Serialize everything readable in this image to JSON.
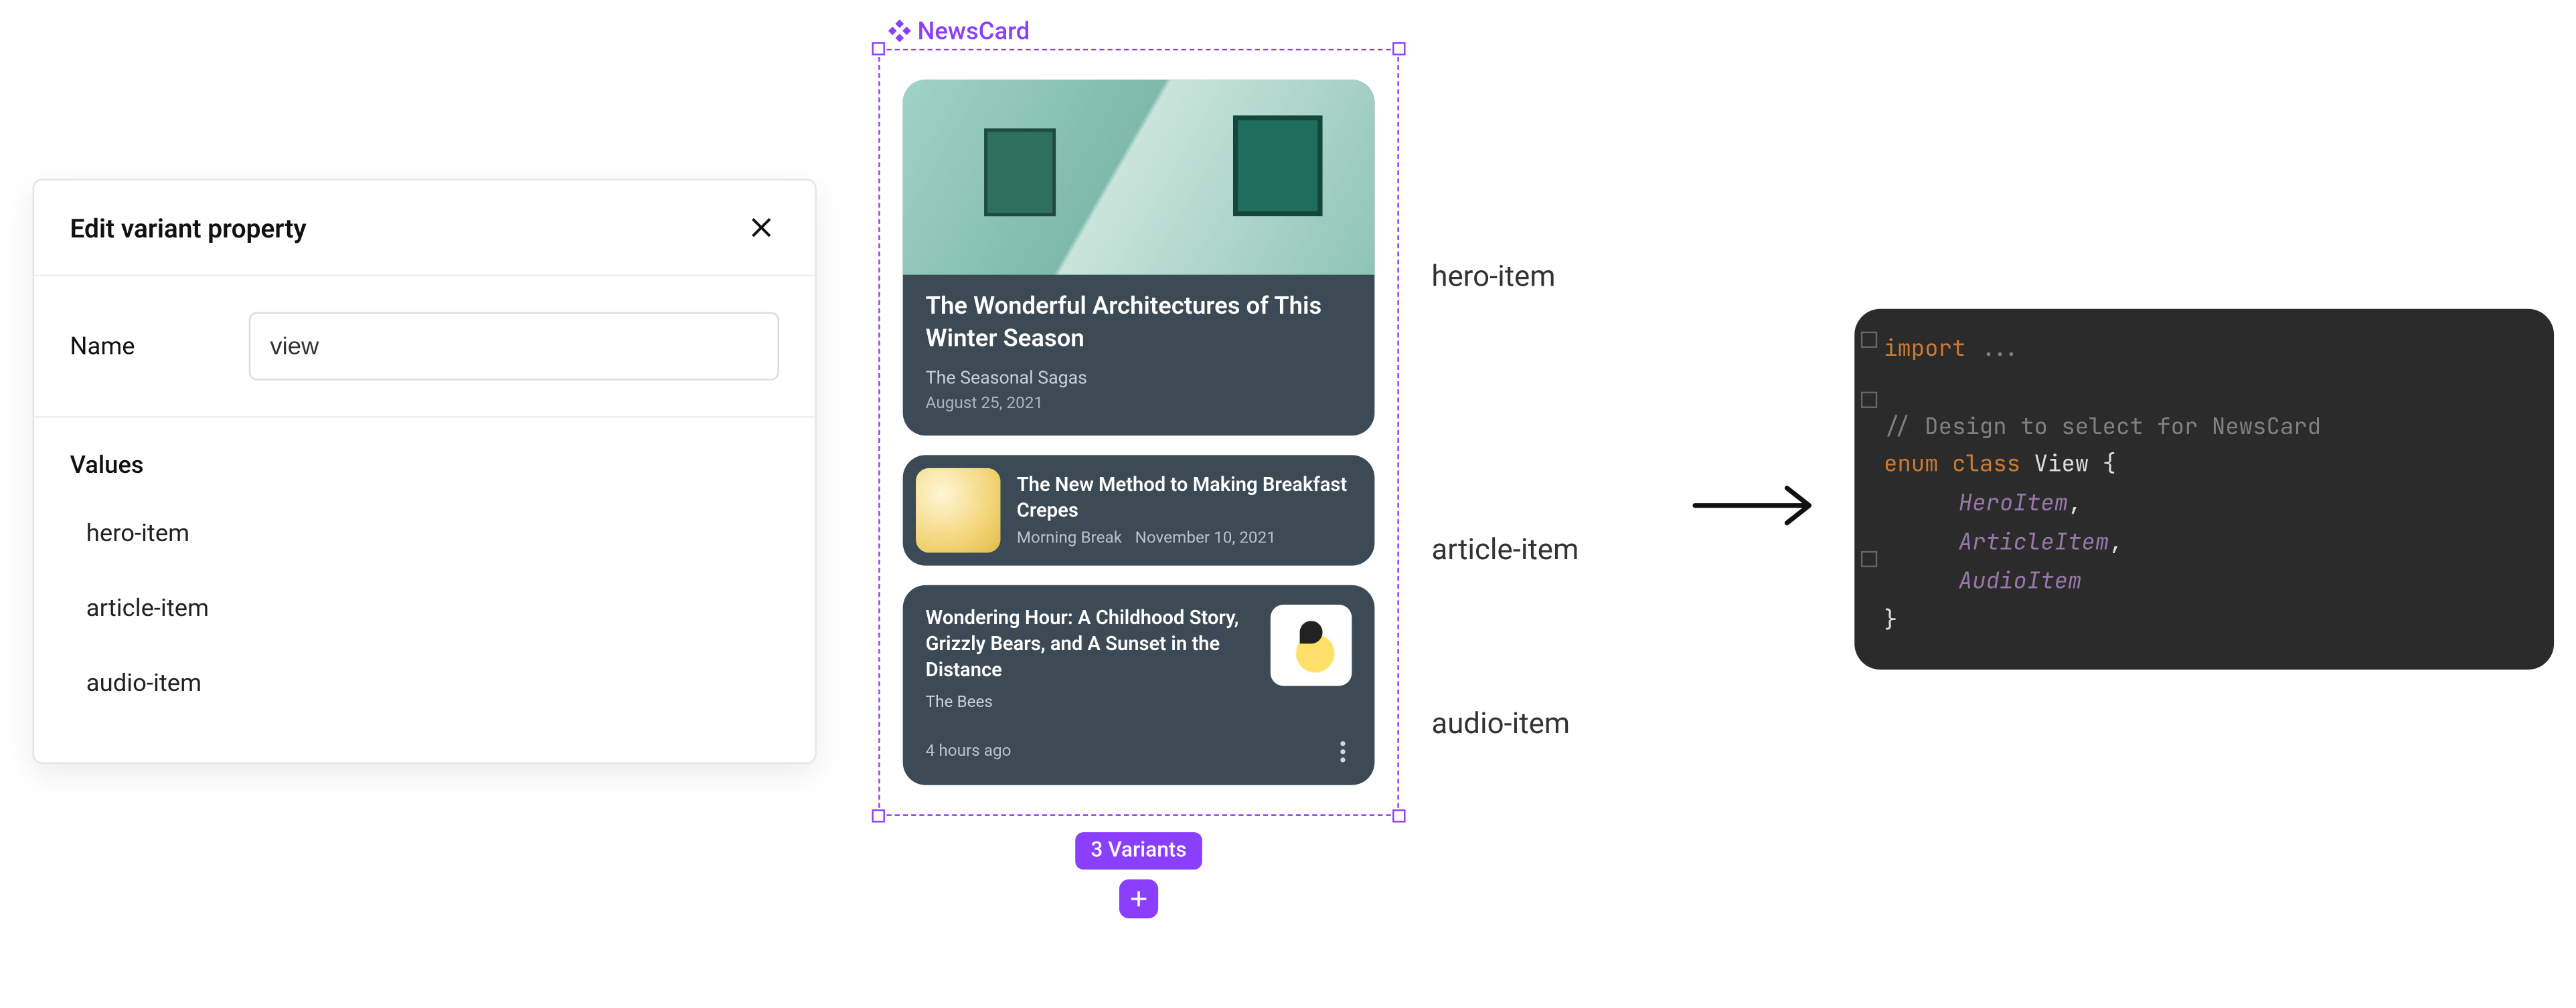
{
  "panel": {
    "title": "Edit variant property",
    "name_label": "Name",
    "name_value": "view",
    "values_label": "Values",
    "values": [
      "hero-item",
      "article-item",
      "audio-item"
    ]
  },
  "component": {
    "name": "NewsCard",
    "variants_badge": "3 Variants",
    "hero": {
      "title": "The Wonderful Architectures of This Winter Season",
      "subtitle": "The Seasonal Sagas",
      "date": "August 25, 2021"
    },
    "article": {
      "title": "The New Method to Making Breakfast Crepes",
      "source": "Morning Break",
      "date": "November 10, 2021"
    },
    "audio": {
      "title": "Wondering Hour: A Childhood Story, Grizzly Bears, and A Sunset in the Distance",
      "subtitle": "The Bees",
      "time": "4 hours ago"
    }
  },
  "annotations": {
    "hero": "hero-item",
    "article": "article-item",
    "audio": "audio-item"
  },
  "code": {
    "import_kw": "import",
    "import_rest": " ...",
    "comment": "// Design to select for NewsCard",
    "enum_kw": "enum",
    "class_kw": "class",
    "enum_name": "View",
    "brace_open": " {",
    "members": [
      "HeroItem",
      "ArticleItem",
      "AudioItem"
    ],
    "comma": ",",
    "brace_close": "}"
  }
}
